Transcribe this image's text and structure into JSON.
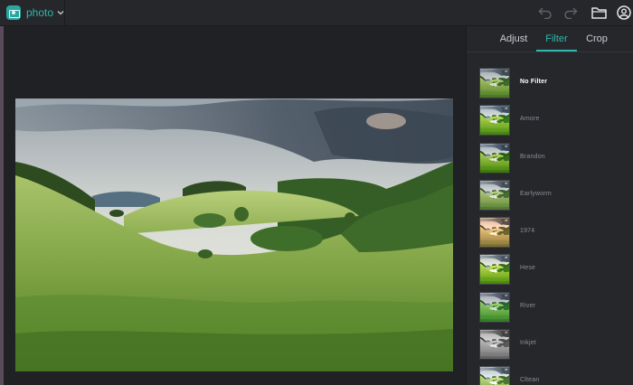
{
  "app": {
    "name": "photo",
    "logo_icon": "camera-icon"
  },
  "toolbar": {
    "undo_icon": "undo-icon",
    "redo_icon": "redo-icon",
    "open_icon": "folder-icon",
    "account_icon": "account-icon"
  },
  "panel": {
    "tabs": [
      {
        "label": "Adjust",
        "active": false
      },
      {
        "label": "Filter",
        "active": true
      },
      {
        "label": "Crop",
        "active": false
      }
    ],
    "filters": [
      {
        "label": "No Filter",
        "selected": true
      },
      {
        "label": "Amore",
        "selected": false
      },
      {
        "label": "Brandon",
        "selected": false
      },
      {
        "label": "Earlyworm",
        "selected": false
      },
      {
        "label": "1974",
        "selected": false
      },
      {
        "label": "Hese",
        "selected": false
      },
      {
        "label": "River",
        "selected": false
      },
      {
        "label": "Inkjet",
        "selected": false
      },
      {
        "label": "Cltean",
        "selected": false
      }
    ]
  },
  "colors": {
    "accent": "#2fb7ae",
    "background": "#1f2124",
    "panel": "#25272b"
  }
}
